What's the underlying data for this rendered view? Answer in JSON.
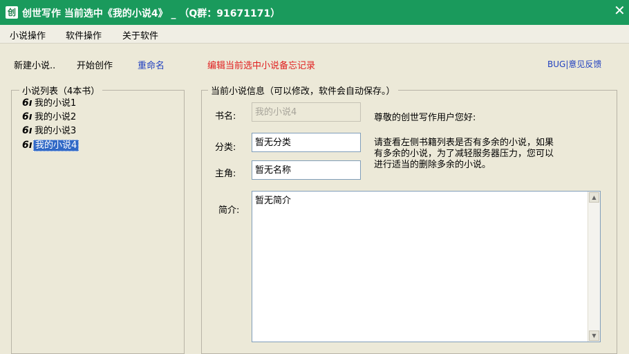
{
  "window": {
    "icon_char": "创",
    "title": "创世写作 当前选中《我的小说4》 _ （Q群：91671171）",
    "close_symbol": "✕"
  },
  "menu": [
    "小说操作",
    "软件操作",
    "关于软件"
  ],
  "toolbar": {
    "new_novel": "新建小说..",
    "start_writing": "开始创作",
    "rename": "重命名",
    "edit_notes": "编辑当前选中小说备忘记录",
    "bug_feedback": "BUG|意见反馈"
  },
  "colors": {
    "titlebar": "#1a9a5c",
    "rename": "#1f3fbf",
    "edit_notes": "#e02020",
    "feedback": "#1f3fbf",
    "selected": "#3169c6"
  },
  "novel_list": {
    "title": "小说列表（4本书）",
    "items": [
      {
        "label": "我的小说1",
        "selected": false
      },
      {
        "label": "我的小说2",
        "selected": false
      },
      {
        "label": "我的小说3",
        "selected": false
      },
      {
        "label": "我的小说4",
        "selected": true
      }
    ]
  },
  "novel_info": {
    "title": "当前小说信息（可以修改，软件会自动保存。）",
    "book_name_label": "书名:",
    "book_name_value": "我的小说4",
    "category_label": "分类:",
    "category_value": "暂无分类",
    "protagonist_label": "主角:",
    "protagonist_value": "暂无名称",
    "intro_label": "简介:",
    "intro_value": "暂无简介",
    "greeting": "尊敬的创世写作用户您好:",
    "notice_lines": [
      "请查看左侧书籍列表是否有多余的小说，如果",
      "有多余的小说，为了减轻服务器压力，您可以",
      "进行适当的删除多余的小说。"
    ]
  }
}
